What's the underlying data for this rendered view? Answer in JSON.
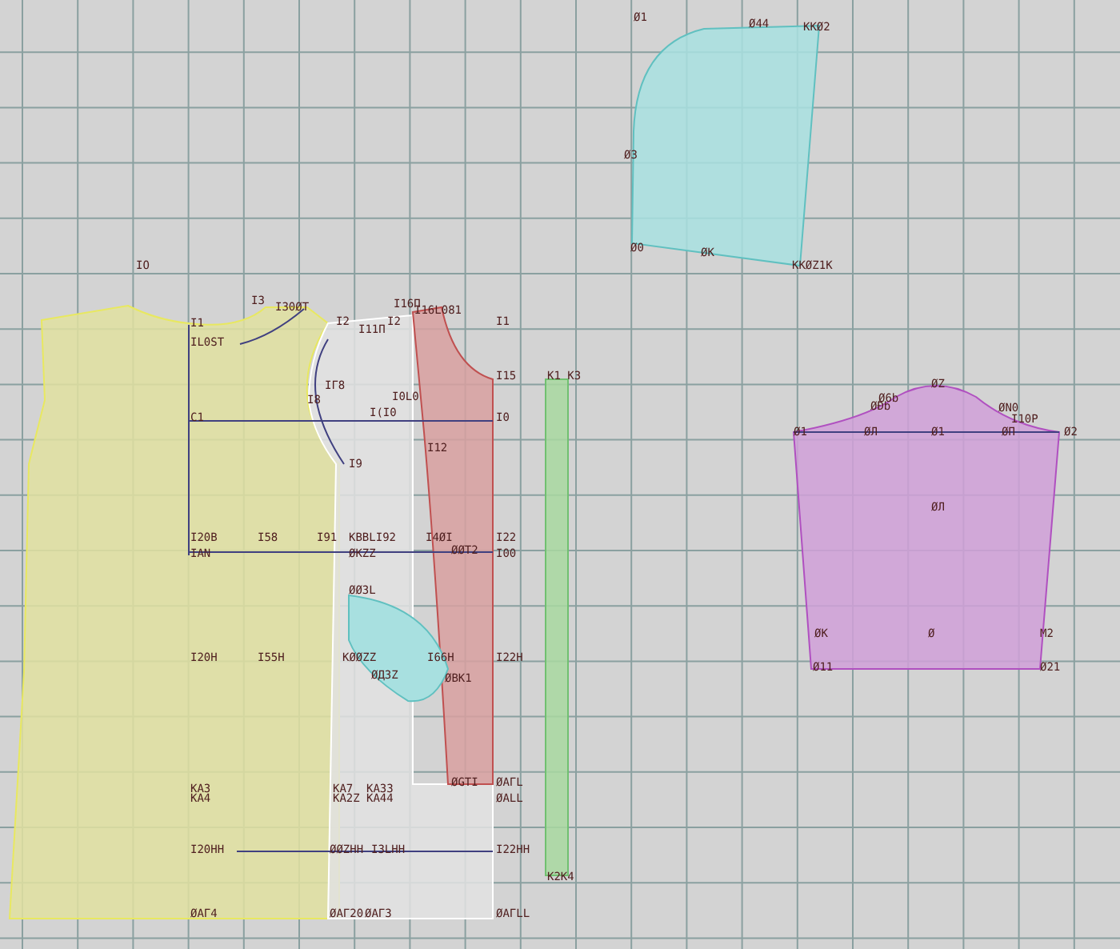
{
  "pieces": [
    {
      "kind": "cap",
      "color": "#a8e0e0",
      "labels": [
        "Ø1",
        "Ø44",
        "KKØ2",
        "Ø3",
        "Ø0",
        "ØK",
        "KKØZ1K"
      ]
    },
    {
      "kind": "front",
      "color": "#e0e0a0",
      "labels": [
        "IO",
        "I3",
        "I30ØT",
        "I1",
        "IL0ST",
        "C1",
        "I20B",
        "I58",
        "IAN",
        "I20H",
        "I55H",
        "KA3",
        "KA4",
        "I20HH",
        "ØAГ4"
      ]
    },
    {
      "kind": "side",
      "color": "#e2e2e2",
      "labels": [
        "I2",
        "I11Π",
        "IГ8",
        "I8",
        "I9",
        "I0L0",
        "I(I0",
        "I91",
        "KBBLI92",
        "ØKZZ",
        "ØØ3L",
        "KØØZZ",
        "ØД3Z",
        "KA7",
        "KA33",
        "KA2Z",
        "KA44",
        "ØØZHH",
        "I3LHH",
        "ØAГ20",
        "ØAГ3",
        "I2"
      ]
    },
    {
      "kind": "back",
      "color": "#d8a0a0",
      "labels": [
        "I16Π",
        "I16L081",
        "I1",
        "I15",
        "I0",
        "I12",
        "I4ØI",
        "ØØT2",
        "I22",
        "I00",
        "I66H",
        "ØBK1",
        "I22H",
        "ØGTI",
        "ØAГL",
        "ØALL",
        "I22HH",
        "ØAГLL"
      ]
    },
    {
      "kind": "strip",
      "color": "#a8d8a0",
      "labels": [
        "K1 K3",
        "K2K4"
      ]
    },
    {
      "kind": "sleeve",
      "color": "#d0a0d8",
      "labels": [
        "ØZ",
        "Ø6b",
        "ØÐb",
        "ØN0",
        "I10P",
        "Ø1",
        "ØЛ",
        "Ø1",
        "ØП",
        "Ø2",
        "ØЛ",
        "ØK",
        "Ø",
        "M2",
        "Ø11",
        "Ø21"
      ]
    }
  ]
}
